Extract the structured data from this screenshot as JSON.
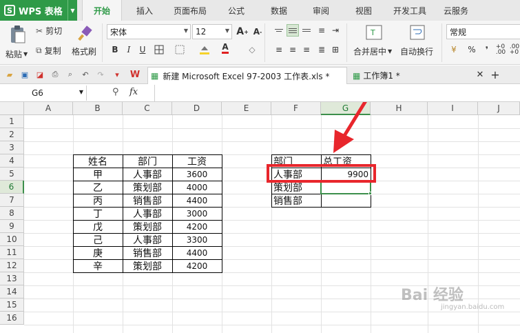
{
  "app": {
    "logo_text": "WPS 表格",
    "logo_glyph": "S"
  },
  "tabs": [
    "开始",
    "插入",
    "页面布局",
    "公式",
    "数据",
    "审阅",
    "视图",
    "开发工具",
    "云服务"
  ],
  "ribbon": {
    "paste": "粘贴",
    "cut": "剪切",
    "copy": "复制",
    "format_painter": "格式刷",
    "font_name": "宋体",
    "font_size": "12",
    "bold": "B",
    "italic": "I",
    "underline": "U",
    "merge_center": "合并居中",
    "wrap_text": "自动换行",
    "number_format": "常规",
    "percent": "%",
    "comma": "❜"
  },
  "docs": [
    {
      "title": "新建 Microsoft Excel 97-2003 工作表.xls *"
    },
    {
      "title": "工作簿1 *"
    }
  ],
  "formula_bar": {
    "name_box": "G6",
    "fx": "fx",
    "formula": ""
  },
  "grid": {
    "columns": [
      "A",
      "B",
      "C",
      "D",
      "E",
      "F",
      "G",
      "H",
      "I",
      "J"
    ],
    "rows": [
      "1",
      "2",
      "3",
      "4",
      "5",
      "6",
      "7",
      "8",
      "9",
      "10",
      "11",
      "12",
      "13",
      "14",
      "15",
      "16"
    ],
    "selected_cell": "G6",
    "table1": {
      "headers": [
        "姓名",
        "部门",
        "工资"
      ],
      "rows": [
        [
          "甲",
          "人事部",
          "3600"
        ],
        [
          "乙",
          "策划部",
          "4000"
        ],
        [
          "丙",
          "销售部",
          "4400"
        ],
        [
          "丁",
          "人事部",
          "3000"
        ],
        [
          "戊",
          "策划部",
          "4200"
        ],
        [
          "己",
          "人事部",
          "3300"
        ],
        [
          "庚",
          "销售部",
          "4400"
        ],
        [
          "辛",
          "策划部",
          "4200"
        ]
      ]
    },
    "table2": {
      "headers": [
        "部门",
        "总工资"
      ],
      "rows": [
        [
          "人事部",
          "9900"
        ],
        [
          "策划部",
          ""
        ],
        [
          "销售部",
          ""
        ]
      ]
    }
  },
  "annotation": {
    "highlight_color": "#e8262c"
  },
  "watermark": {
    "text": "Bai 经验",
    "subtext": "jingyan.baidu.com"
  }
}
